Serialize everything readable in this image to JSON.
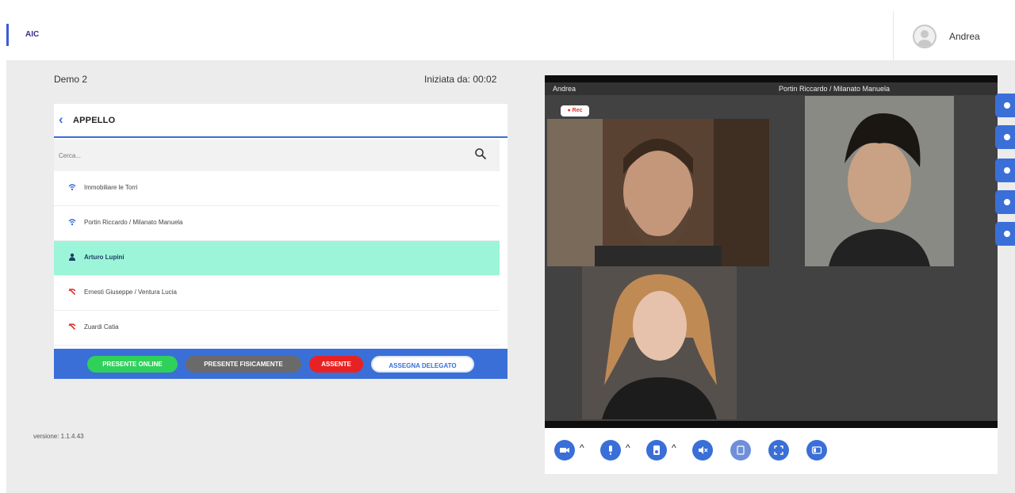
{
  "header": {
    "brand": "AIC",
    "username": "Andrea"
  },
  "session": {
    "title": "Demo 2",
    "started": "Iniziata da: 00:02"
  },
  "appello": {
    "title": "APPELLO",
    "search_placeholder": "Cerca...",
    "rows": [
      {
        "label": "Immobiliare le Torri",
        "icon": "wifi-icon"
      },
      {
        "label": "Portin Riccardo / Milanato Manuela",
        "icon": "wifi-icon"
      },
      {
        "label": "Arturo Lupini",
        "icon": "person-icon",
        "selected": true
      },
      {
        "label": "Ernesti Giuseppe / Ventura Lucia",
        "icon": "absent-icon"
      },
      {
        "label": "Zuardi Catia",
        "icon": "absent-icon"
      }
    ],
    "actions": {
      "online": "PRESENTE ONLINE",
      "fisico": "PRESENTE FISICAMENTE",
      "assente": "ASSENTE",
      "delegato": "ASSEGNA DELEGATO"
    }
  },
  "version": "versione: 1.1.4.43",
  "video": {
    "labels": [
      "Andrea",
      "Portin Riccardo / Milanato Manuela"
    ],
    "rec": "● Rec"
  },
  "colors": {
    "accent": "#3a6fd8",
    "online": "#2fd15a",
    "fisico": "#6a6a6a",
    "assente": "#e82222",
    "selected_row": "#9cf5d9"
  }
}
